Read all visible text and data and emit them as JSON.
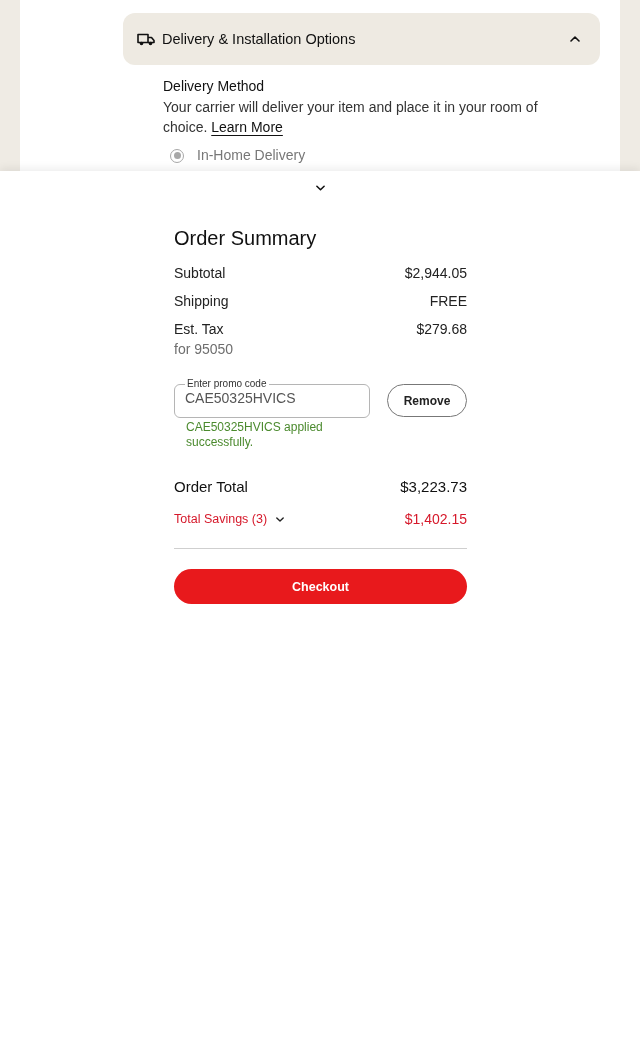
{
  "accordion": {
    "title": "Delivery & Installation Options",
    "expanded": true,
    "section_title": "Delivery Method",
    "description": "Your carrier will deliver your item and place it in your room of choice.",
    "link": "Learn More",
    "options": [
      {
        "label": "In-Home Delivery",
        "selected": true
      }
    ]
  },
  "order_summary": {
    "title": "Order Summary",
    "rows": [
      {
        "label": "Subtotal",
        "value": "$2,944.05"
      },
      {
        "label": "Shipping",
        "value": "FREE"
      },
      {
        "label": "Est. Tax",
        "note": "for 95050",
        "value": "$279.68"
      }
    ],
    "promo": {
      "label": "Enter promo code",
      "value": "CAE50325HVICS",
      "button": "Remove",
      "message": "CAE50325HVICS applied successfully."
    },
    "total": {
      "label": "Order Total",
      "value": "$3,223.73"
    },
    "savings": {
      "label": "Total Savings (3)",
      "expanded": false,
      "value": "$1,402.15"
    },
    "checkout": "Checkout"
  }
}
